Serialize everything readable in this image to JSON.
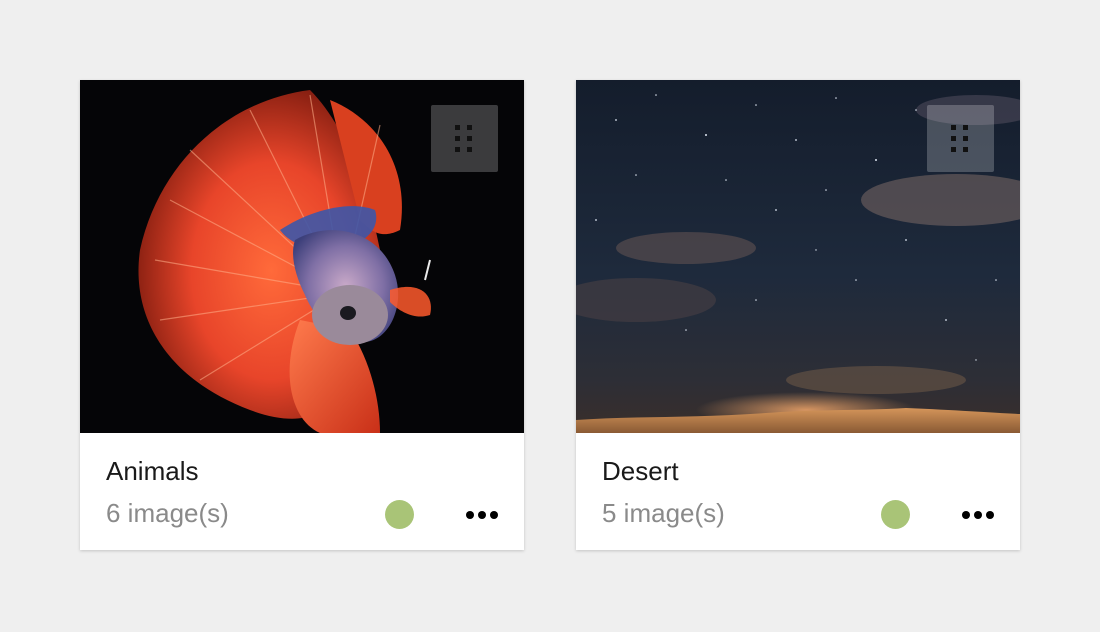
{
  "colors": {
    "page_background": "#efefef",
    "card_background": "#ffffff",
    "status_active": "#a9c477",
    "title_text": "#1a1a1a",
    "count_text": "#8a8a8a"
  },
  "albums": [
    {
      "title": "Animals",
      "count_label": "6 image(s)",
      "thumbnail": "betta-fish-photo",
      "status": "active",
      "drag_icon": "drag-handle-icon",
      "menu_icon": "more-horizontal-icon"
    },
    {
      "title": "Desert",
      "count_label": "5 image(s)",
      "thumbnail": "desert-night-sky-photo",
      "status": "active",
      "drag_icon": "drag-handle-icon",
      "menu_icon": "more-horizontal-icon"
    }
  ]
}
